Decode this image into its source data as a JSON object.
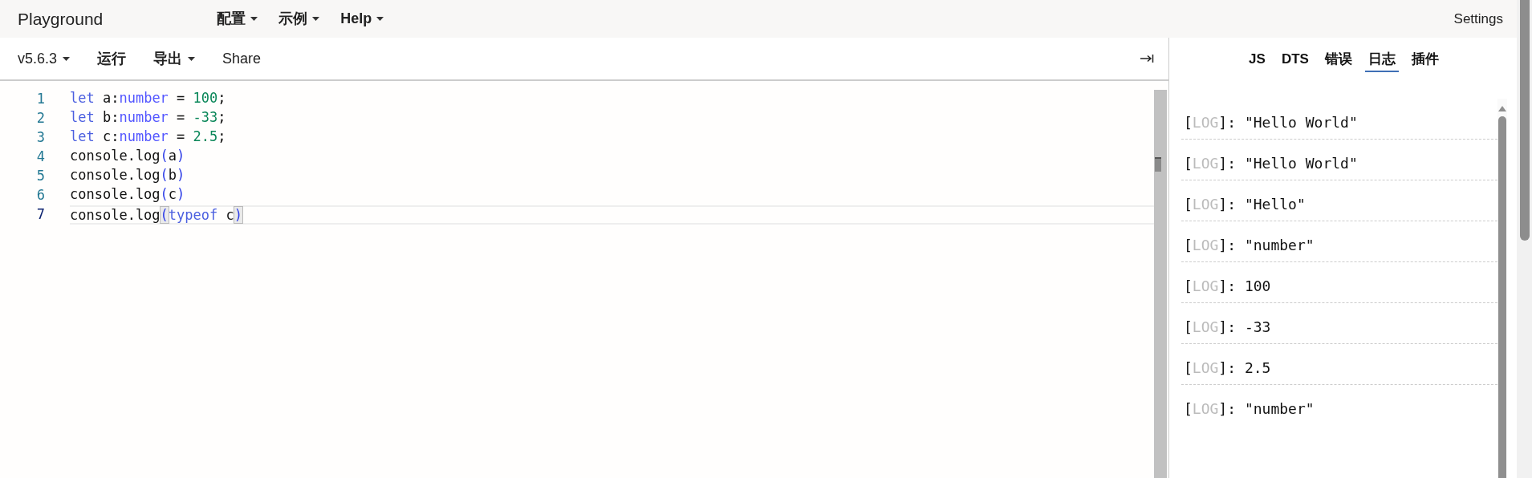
{
  "navbar": {
    "brand": "Playground",
    "menus": [
      {
        "label": "配置",
        "has_caret": true
      },
      {
        "label": "示例",
        "has_caret": true
      },
      {
        "label": "Help",
        "has_caret": true
      }
    ],
    "settings": "Settings"
  },
  "toolbar": {
    "items": [
      {
        "label": "v5.6.3",
        "has_caret": true,
        "bold": false
      },
      {
        "label": "运行",
        "has_caret": false,
        "bold": true
      },
      {
        "label": "导出",
        "has_caret": true,
        "bold": true
      },
      {
        "label": "Share",
        "has_caret": false,
        "bold": false
      }
    ]
  },
  "editor": {
    "lines": [
      {
        "number": "1",
        "current": false,
        "tokens": [
          {
            "kind": "keyword",
            "text": "let"
          },
          {
            "kind": "plain",
            "text": " a:"
          },
          {
            "kind": "type",
            "text": "number"
          },
          {
            "kind": "plain",
            "text": " = "
          },
          {
            "kind": "literal",
            "text": "100"
          },
          {
            "kind": "plain",
            "text": ";"
          }
        ]
      },
      {
        "number": "2",
        "current": false,
        "tokens": [
          {
            "kind": "keyword",
            "text": "let"
          },
          {
            "kind": "plain",
            "text": " b:"
          },
          {
            "kind": "type",
            "text": "number"
          },
          {
            "kind": "plain",
            "text": " = "
          },
          {
            "kind": "literal",
            "text": "-33"
          },
          {
            "kind": "plain",
            "text": ";"
          }
        ]
      },
      {
        "number": "3",
        "current": false,
        "tokens": [
          {
            "kind": "keyword",
            "text": "let"
          },
          {
            "kind": "plain",
            "text": " c:"
          },
          {
            "kind": "type",
            "text": "number"
          },
          {
            "kind": "plain",
            "text": " = "
          },
          {
            "kind": "literal",
            "text": "2.5"
          },
          {
            "kind": "plain",
            "text": ";"
          }
        ]
      },
      {
        "number": "4",
        "current": false,
        "tokens": [
          {
            "kind": "plain",
            "text": "console.log"
          },
          {
            "kind": "paren",
            "text": "("
          },
          {
            "kind": "plain",
            "text": "a"
          },
          {
            "kind": "paren",
            "text": ")"
          }
        ]
      },
      {
        "number": "5",
        "current": false,
        "tokens": [
          {
            "kind": "plain",
            "text": "console.log"
          },
          {
            "kind": "paren",
            "text": "("
          },
          {
            "kind": "plain",
            "text": "b"
          },
          {
            "kind": "paren",
            "text": ")"
          }
        ]
      },
      {
        "number": "6",
        "current": false,
        "tokens": [
          {
            "kind": "plain",
            "text": "console.log"
          },
          {
            "kind": "paren",
            "text": "("
          },
          {
            "kind": "plain",
            "text": "c"
          },
          {
            "kind": "paren",
            "text": ")"
          }
        ]
      },
      {
        "number": "7",
        "current": true,
        "tokens": [
          {
            "kind": "plain",
            "text": "console.log"
          },
          {
            "kind": "paren-match",
            "text": "("
          },
          {
            "kind": "keyword",
            "text": "typeof"
          },
          {
            "kind": "plain",
            "text": " c"
          },
          {
            "kind": "paren-match",
            "text": ")"
          }
        ]
      }
    ]
  },
  "panel": {
    "tabs": [
      {
        "label": "JS",
        "selected": false
      },
      {
        "label": "DTS",
        "selected": false
      },
      {
        "label": "错误",
        "selected": false
      },
      {
        "label": "日志",
        "selected": true
      },
      {
        "label": "插件",
        "selected": false
      }
    ],
    "logs": [
      {
        "open": "[",
        "tag": "LOG",
        "close": "]:",
        "message": "\"Hello World\""
      },
      {
        "open": "[",
        "tag": "LOG",
        "close": "]:",
        "message": "\"Hello World\""
      },
      {
        "open": "[",
        "tag": "LOG",
        "close": "]:",
        "message": "\"Hello\""
      },
      {
        "open": "[",
        "tag": "LOG",
        "close": "]:",
        "message": "\"number\""
      },
      {
        "open": "[",
        "tag": "LOG",
        "close": "]:",
        "message": "100"
      },
      {
        "open": "[",
        "tag": "LOG",
        "close": "]:",
        "message": "-33"
      },
      {
        "open": "[",
        "tag": "LOG",
        "close": "]:",
        "message": "2.5"
      },
      {
        "open": "[",
        "tag": "LOG",
        "close": "]:",
        "message": "\"number\""
      }
    ]
  }
}
